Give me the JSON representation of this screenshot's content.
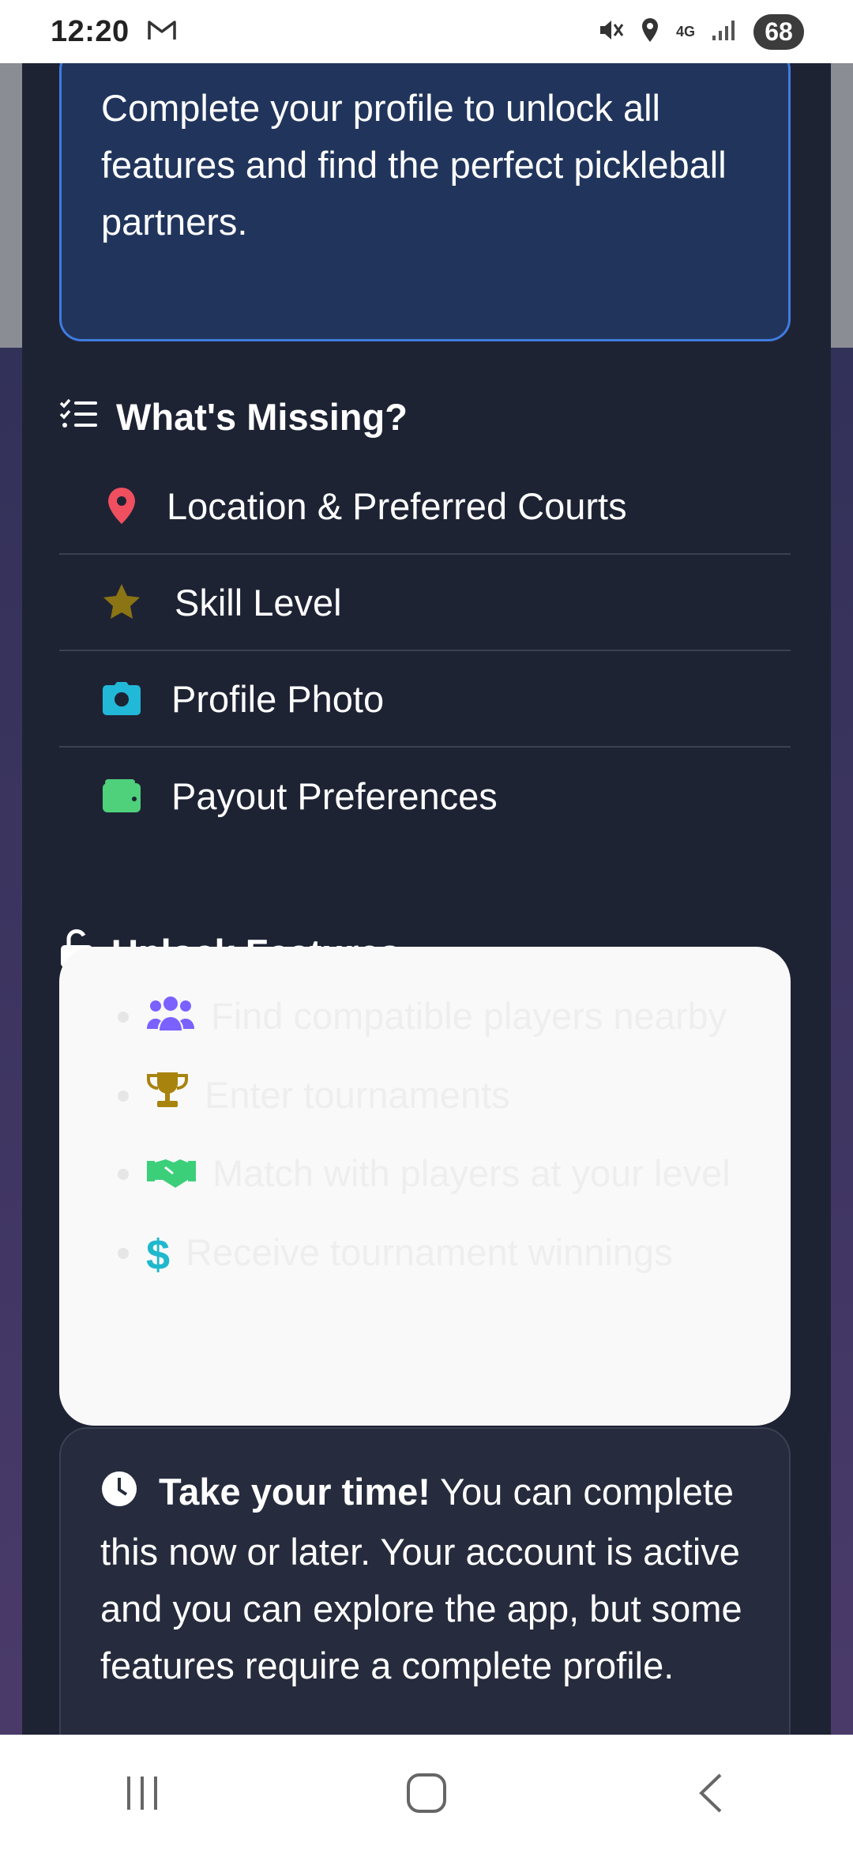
{
  "status_bar": {
    "time": "12:20",
    "network": "4G",
    "battery": "68"
  },
  "intro": {
    "text": "Complete your profile to unlock all features and find the perfect pickleball partners."
  },
  "missing": {
    "title": "What's Missing?",
    "items": [
      {
        "label": "Location & Preferred Courts",
        "icon": "map-pin-icon",
        "color": "#ef4f5f"
      },
      {
        "label": "Skill Level",
        "icon": "star-icon",
        "color": "#8a7414"
      },
      {
        "label": "Profile Photo",
        "icon": "camera-icon",
        "color": "#22b8d8"
      },
      {
        "label": "Payout Preferences",
        "icon": "wallet-icon",
        "color": "#4fd07b"
      }
    ]
  },
  "unlock": {
    "title": "Unlock Features:",
    "items": [
      {
        "label": "Find compatible players nearby",
        "icon": "users-icon",
        "color": "#7b61ff"
      },
      {
        "label": "Enter tournaments",
        "icon": "trophy-icon",
        "color": "#a8840e"
      },
      {
        "label": "Match with players at your level",
        "icon": "handshake-icon",
        "color": "#3ccf7a"
      },
      {
        "label": "Receive tournament winnings",
        "icon": "dollar-icon",
        "color": "#1fb8cc"
      }
    ]
  },
  "take_time": {
    "bold": "Take your time!",
    "text": " You can complete this now or later. Your account is active and you can explore the app, but some features require a complete profile."
  },
  "colors": {
    "panel": "#1e2334",
    "accent_border": "#3f7ce0",
    "intro_bg": "#21355c"
  }
}
